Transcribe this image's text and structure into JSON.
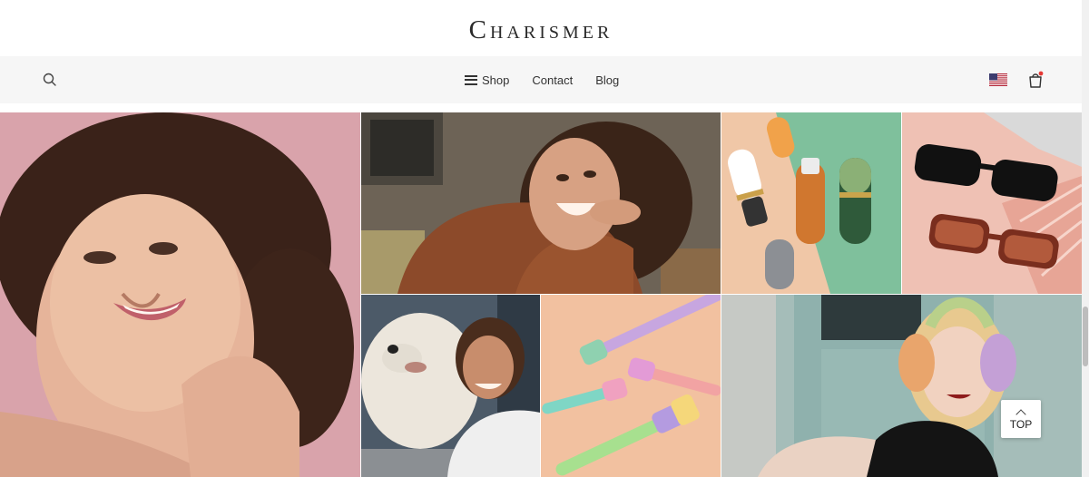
{
  "brand": {
    "logo_text": "Charismer"
  },
  "nav": {
    "search_icon": "search-icon",
    "menu": [
      {
        "label": "Shop",
        "icon": "hamburger-icon"
      },
      {
        "label": "Contact"
      },
      {
        "label": "Blog"
      }
    ],
    "flag_icon": "us-flag-icon",
    "cart_icon": "shopping-bag-icon",
    "cart_badge_color": "#e53935"
  },
  "gallery": {
    "tiles": [
      {
        "subject": "woman-smiling-pink-background"
      },
      {
        "subject": "woman-brown-sweater-smiling"
      },
      {
        "subject": "cosmetic-tubes-green-peach"
      },
      {
        "subject": "sunglasses-pink-background"
      },
      {
        "subject": "woman-with-white-dog"
      },
      {
        "subject": "colorful-toothbrushes"
      },
      {
        "subject": "woman-headphones-black-tshirt"
      }
    ]
  },
  "back_to_top": {
    "label": "TOP",
    "icon": "chevron-up-icon"
  }
}
